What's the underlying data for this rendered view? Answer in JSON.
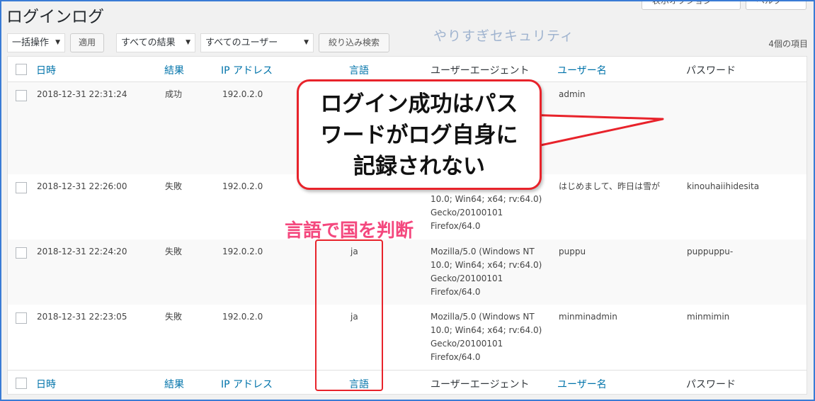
{
  "page": {
    "title": "ログインログ"
  },
  "top_buttons": {
    "screen_options": "表示オプション",
    "help": "ヘルプ"
  },
  "watermark": "やりすぎセキュリティ",
  "toolbar": {
    "bulk_action": "一括操作",
    "apply": "適用",
    "results_filter": "すべての結果",
    "user_filter": "すべてのユーザー",
    "filter_button": "絞り込み検索"
  },
  "item_count": "4個の項目",
  "columns": {
    "datetime": "日時",
    "result": "結果",
    "ip": "IP アドレス",
    "language": "言語",
    "user_agent": "ユーザーエージェント",
    "username": "ユーザー名",
    "password": "パスワード"
  },
  "rows": [
    {
      "datetime": "2018-12-31 22:31:24",
      "result": "成功",
      "ip": "192.0.2.0",
      "language": "",
      "user_agent": "",
      "username": "admin",
      "password": ""
    },
    {
      "datetime": "2018-12-31 22:26:00",
      "result": "失敗",
      "ip": "192.0.2.0",
      "language": "",
      "user_agent": "10.0; Win64; x64; rv:64.0) Gecko/20100101 Firefox/64.0",
      "username": "はじめまして、昨日は雪が",
      "password": "kinouhaiihidesita"
    },
    {
      "datetime": "2018-12-31 22:24:20",
      "result": "失敗",
      "ip": "192.0.2.0",
      "language": "ja",
      "user_agent": "Mozilla/5.0 (Windows NT 10.0; Win64; x64; rv:64.0) Gecko/20100101 Firefox/64.0",
      "username": "puppu",
      "password": "puppuppu-"
    },
    {
      "datetime": "2018-12-31 22:23:05",
      "result": "失敗",
      "ip": "192.0.2.0",
      "language": "ja",
      "user_agent": "Mozilla/5.0 (Windows NT 10.0; Win64; x64; rv:64.0) Gecko/20100101 Firefox/64.0",
      "username": "minminadmin",
      "password": "minmimin"
    }
  ],
  "callout": {
    "line1": "ログイン成功はパス",
    "line2": "ワードがログ自身に",
    "line3": "記録されない"
  },
  "annotation": "言語で国を判断",
  "colors": {
    "link": "#0073aa",
    "annotation_red": "#e8232b",
    "annotation_pink": "#f4487e",
    "frame_blue": "#3a7bd5"
  }
}
